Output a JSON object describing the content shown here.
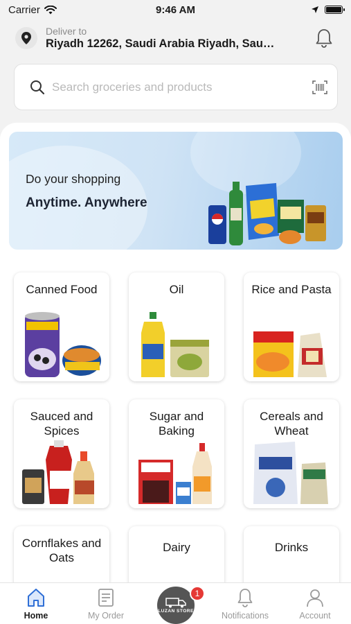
{
  "status_bar": {
    "carrier": "Carrier",
    "time": "9:46 AM",
    "battery_level": 1.0
  },
  "header": {
    "deliver_label": "Deliver to",
    "address": "Riyadh 12262, Saudi Arabia Riyadh, Sau…"
  },
  "search": {
    "placeholder": "Search groceries and products"
  },
  "banner": {
    "line1": "Do your shopping",
    "line2": "Anytime. Anywhere"
  },
  "categories": [
    {
      "title": "Canned Food",
      "icon": "canned-food-image"
    },
    {
      "title": "Oil",
      "icon": "oil-image"
    },
    {
      "title": "Rice and Pasta",
      "icon": "rice-pasta-image"
    },
    {
      "title": "Sauced and Spices",
      "icon": "sauces-spices-image"
    },
    {
      "title": "Sugar and Baking",
      "icon": "sugar-baking-image"
    },
    {
      "title": "Cereals and Wheat",
      "icon": "cereals-wheat-image"
    },
    {
      "title": "Cornflakes and Oats",
      "icon": "cornflakes-oats-image"
    },
    {
      "title": "Dairy",
      "icon": "dairy-image"
    },
    {
      "title": "Drinks",
      "icon": "drinks-image"
    }
  ],
  "tabbar": {
    "home": "Home",
    "my_order": "My Order",
    "store_logo": "LUZAN STORE",
    "cart_badge": "1",
    "notifications": "Notifications",
    "account": "Account"
  },
  "colors": {
    "accent": "#2f6fd6",
    "badge": "#e53935",
    "background": "#f2f2f2"
  }
}
